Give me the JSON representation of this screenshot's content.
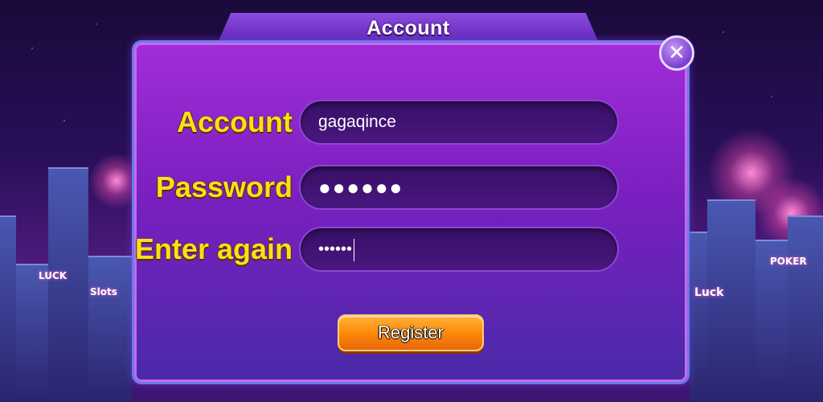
{
  "dialog": {
    "title": "Account",
    "close_symbol": "✕"
  },
  "form": {
    "account": {
      "label": "Account",
      "value": "gagaqince"
    },
    "password": {
      "label": "Password",
      "value": "●●●●●●"
    },
    "confirm": {
      "label": "Enter again",
      "value": "••••••"
    }
  },
  "register_label": "Register",
  "background": {
    "signs": [
      "LUCK",
      "Slots",
      "Luck",
      "POKER"
    ]
  },
  "colors": {
    "label": "#f8e01a",
    "panel": "#8a2ad0",
    "register": "#ff8a0a"
  }
}
